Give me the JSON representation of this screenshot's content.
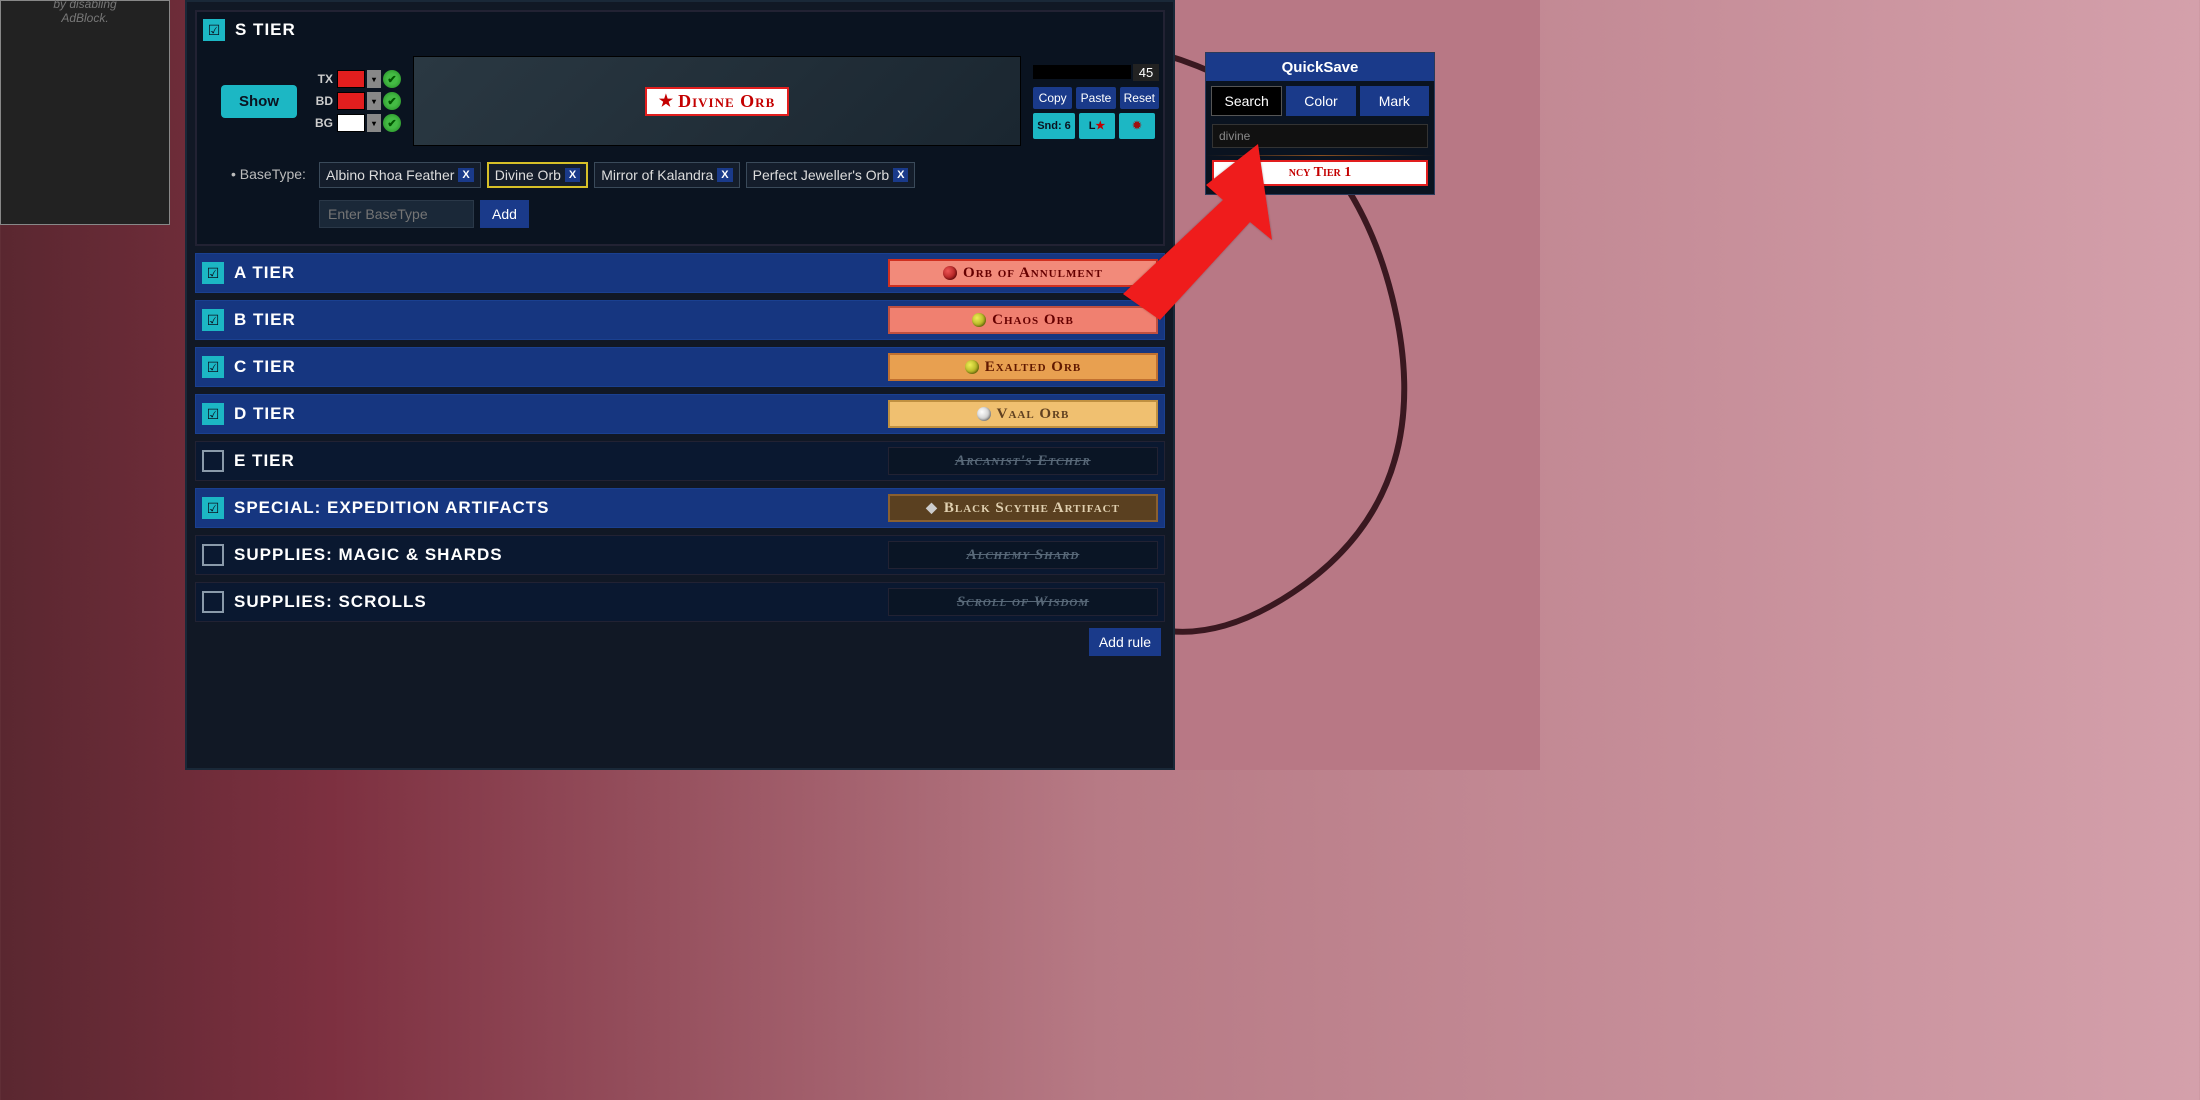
{
  "adblock": {
    "line1": "by disabling",
    "line2": "AdBlock."
  },
  "bullet": "•",
  "checkmark": "☑",
  "s_tier": {
    "title": "S TIER",
    "show_label": "Show",
    "color_labels": {
      "tx": "TX",
      "bd": "BD",
      "bg": "BG"
    },
    "preview_item": "Divine Orb",
    "size_value": "45",
    "buttons": {
      "copy": "Copy",
      "paste": "Paste",
      "reset": "Reset",
      "sound": "Snd: 6"
    },
    "basetype_label": "BaseType:",
    "basetype_tags": [
      "Albino Rhoa Feather",
      "Divine Orb",
      "Mirror of Kalandra",
      "Perfect Jeweller's Orb"
    ],
    "basetype_selected_index": 1,
    "input_placeholder": "Enter BaseType",
    "add_label": "Add"
  },
  "tiers": [
    {
      "checked": true,
      "title": "A TIER",
      "chip": "Orb of Annulment",
      "style": "chip-a",
      "dot": "red"
    },
    {
      "checked": true,
      "title": "B TIER",
      "chip": "Chaos Orb",
      "style": "chip-b",
      "dot": "yellow"
    },
    {
      "checked": true,
      "title": "C TIER",
      "chip": "Exalted Orb",
      "style": "chip-c",
      "dot": "yellow"
    },
    {
      "checked": true,
      "title": "D TIER",
      "chip": "Vaal Orb",
      "style": "chip-d",
      "dot": "white"
    },
    {
      "checked": false,
      "title": "E TIER",
      "chip": "Arcanist's Etcher",
      "style": "chip-off",
      "dot": ""
    },
    {
      "checked": true,
      "title": "SPECIAL: EXPEDITION ARTIFACTS",
      "chip": "Black Scythe Artifact",
      "style": "chip-exp",
      "dot": "diamond"
    },
    {
      "checked": false,
      "title": "SUPPLIES: MAGIC & SHARDS",
      "chip": "Alchemy Shard",
      "style": "chip-off",
      "dot": ""
    },
    {
      "checked": false,
      "title": "SUPPLIES: SCROLLS",
      "chip": "Scroll of Wisdom",
      "style": "chip-off",
      "dot": ""
    }
  ],
  "add_rule_label": "Add rule",
  "quicksave": {
    "title": "QuickSave",
    "tabs": {
      "search": "Search",
      "color": "Color",
      "mark": "Mark"
    },
    "search_value": "divine",
    "result": "ncy Tier 1"
  }
}
